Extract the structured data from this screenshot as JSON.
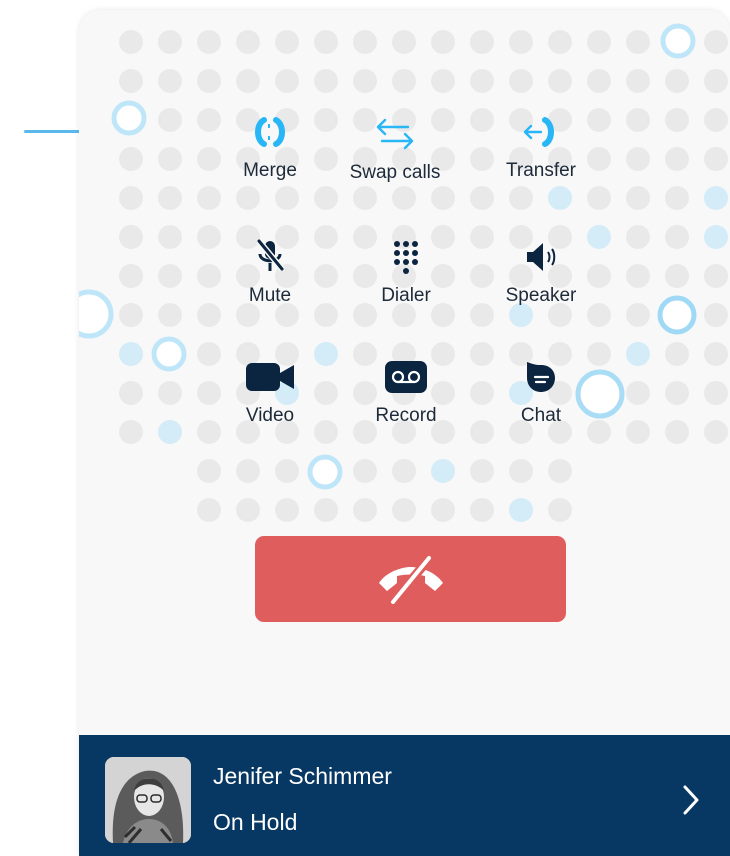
{
  "colors": {
    "accent": "#29b6f6",
    "icon_dark": "#0b2440",
    "hangup_red": "#e05d5d",
    "hold_bar": "#073763",
    "background_dot": "#e9e9e9",
    "accent_dot": "#d3ecf8"
  },
  "controls": [
    {
      "id": "merge",
      "label": "Merge",
      "icon": "merge-icon"
    },
    {
      "id": "swap",
      "label": "Swap calls",
      "icon": "swap-icon"
    },
    {
      "id": "transfer",
      "label": "Transfer",
      "icon": "transfer-icon"
    },
    {
      "id": "mute",
      "label": "Mute",
      "icon": "mic-off-icon"
    },
    {
      "id": "dialer",
      "label": "Dialer",
      "icon": "dialpad-icon"
    },
    {
      "id": "speaker",
      "label": "Speaker",
      "icon": "speaker-icon"
    },
    {
      "id": "video",
      "label": "Video",
      "icon": "video-camera-icon"
    },
    {
      "id": "record",
      "label": "Record",
      "icon": "voicemail-icon"
    },
    {
      "id": "chat",
      "label": "Chat",
      "icon": "chat-bubble-icon"
    }
  ],
  "hangup": {
    "icon": "hang-up-icon"
  },
  "hold_call": {
    "name": "Jenifer Schimmer",
    "status": "On Hold",
    "avatar_icon": "caller-avatar",
    "chevron_icon": "chevron-right-icon"
  }
}
